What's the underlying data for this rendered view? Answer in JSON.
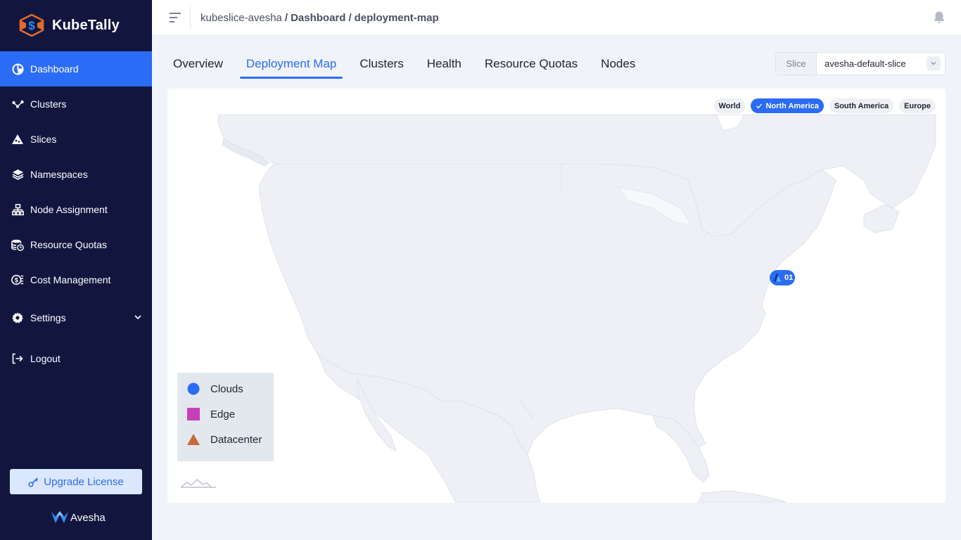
{
  "app": {
    "brand": "KubeTally",
    "footer_brand": "Avesha"
  },
  "sidebar": {
    "items": [
      {
        "label": "Dashboard",
        "icon": "pie-chart-icon",
        "active": true
      },
      {
        "label": "Clusters",
        "icon": "clusters-icon"
      },
      {
        "label": "Slices",
        "icon": "slices-icon"
      },
      {
        "label": "Namespaces",
        "icon": "layers-icon"
      },
      {
        "label": "Node Assignment",
        "icon": "hierarchy-icon"
      },
      {
        "label": "Resource Quotas",
        "icon": "quota-icon"
      },
      {
        "label": "Cost Management",
        "icon": "cost-icon"
      },
      {
        "label": "Settings",
        "icon": "gear-icon",
        "expandable": true
      },
      {
        "label": "Logout",
        "icon": "logout-icon"
      }
    ],
    "upgrade_label": "Upgrade License"
  },
  "header": {
    "breadcrumb": [
      "kubeslice-avesha",
      "Dashboard",
      "deployment-map"
    ],
    "separator": "/"
  },
  "tabs": [
    {
      "label": "Overview"
    },
    {
      "label": "Deployment Map",
      "active": true
    },
    {
      "label": "Clusters"
    },
    {
      "label": "Health"
    },
    {
      "label": "Resource Quotas"
    },
    {
      "label": "Nodes"
    }
  ],
  "slice_selector": {
    "label": "Slice",
    "value": "avesha-default-slice"
  },
  "map": {
    "regions": [
      {
        "label": "World"
      },
      {
        "label": "North America",
        "active": true
      },
      {
        "label": "South America"
      },
      {
        "label": "Europe"
      }
    ],
    "marker": {
      "label": "01",
      "provider_icon": "azure-icon"
    },
    "legend": [
      {
        "label": "Clouds",
        "shape": "circle",
        "color": "#2b6cf6"
      },
      {
        "label": "Edge",
        "shape": "square",
        "color": "#c63fb8"
      },
      {
        "label": "Datacenter",
        "shape": "triangle",
        "color": "#c8693e"
      }
    ]
  },
  "colors": {
    "sidebar": "#12163f",
    "accent": "#2b6cf6",
    "land": "#f0f2f7"
  }
}
